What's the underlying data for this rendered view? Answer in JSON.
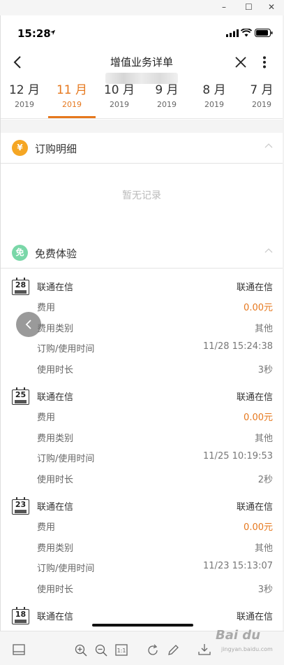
{
  "window": {
    "minimize": "–",
    "maximize": "☐",
    "close": "✕"
  },
  "status_bar": {
    "time": "15:28"
  },
  "nav": {
    "title": "增值业务详单"
  },
  "tabs": [
    {
      "month": "12 月",
      "year": "2019"
    },
    {
      "month": "11 月",
      "year": "2019"
    },
    {
      "month": "10 月",
      "year": "2019"
    },
    {
      "month": "9 月",
      "year": "2019"
    },
    {
      "month": "8 月",
      "year": "2019"
    },
    {
      "month": "7 月",
      "year": "2019"
    }
  ],
  "sections": [
    {
      "icon": "¥",
      "title": "订购明细",
      "empty": "暂无记录"
    },
    {
      "icon": "免",
      "title": "免费体验"
    }
  ],
  "colors": {
    "accent": "#e6781e",
    "icon_yuan": "#f5a623",
    "icon_free": "#7ad7a8"
  },
  "records": [
    {
      "day": "28",
      "rows": [
        {
          "k": "联通在信",
          "v": "联通在信"
        },
        {
          "k": "费用",
          "v": "0.00元"
        },
        {
          "k": "费用类别",
          "v": "其他"
        },
        {
          "k": "订购/使用时间",
          "v": "11/28 15:24:38"
        },
        {
          "k": "使用时长",
          "v": "3秒"
        }
      ]
    },
    {
      "day": "25",
      "rows": [
        {
          "k": "联通在信",
          "v": "联通在信"
        },
        {
          "k": "费用",
          "v": "0.00元"
        },
        {
          "k": "费用类别",
          "v": "其他"
        },
        {
          "k": "订购/使用时间",
          "v": "11/25 10:19:53"
        },
        {
          "k": "使用时长",
          "v": "2秒"
        }
      ]
    },
    {
      "day": "23",
      "rows": [
        {
          "k": "联通在信",
          "v": "联通在信"
        },
        {
          "k": "费用",
          "v": "0.00元"
        },
        {
          "k": "费用类别",
          "v": "其他"
        },
        {
          "k": "订购/使用时间",
          "v": "11/23 15:13:07"
        },
        {
          "k": "使用时长",
          "v": "3秒"
        }
      ]
    },
    {
      "day": "18",
      "rows": [
        {
          "k": "联通在信",
          "v": "联通在信"
        }
      ]
    }
  ],
  "watermark": {
    "logo": "Bai du",
    "sub": "jingyan.baidu.com"
  }
}
